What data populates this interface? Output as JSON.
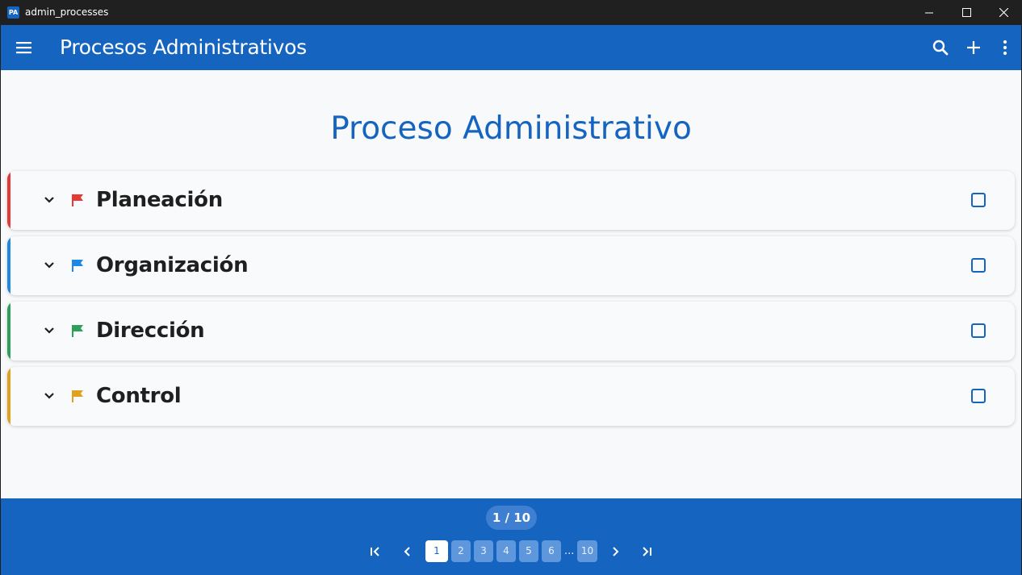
{
  "window": {
    "app_icon_text": "PA",
    "title": "admin_processes"
  },
  "appbar": {
    "title": "Procesos Administrativos",
    "icons": [
      "menu-icon",
      "search-icon",
      "add-icon",
      "more-vert-icon"
    ],
    "color": "#1565c0"
  },
  "main": {
    "heading": "Proceso Administrativo",
    "items": [
      {
        "label": "Planeación",
        "color": "#e53935",
        "checked": false
      },
      {
        "label": "Organización",
        "color": "#1e88e5",
        "checked": false
      },
      {
        "label": "Dirección",
        "color": "#2e9e5b",
        "checked": false
      },
      {
        "label": "Control",
        "color": "#e0a020",
        "checked": false
      }
    ]
  },
  "pagination": {
    "counter": "1 / 10",
    "current_page": 1,
    "pages": [
      "1",
      "2",
      "3",
      "4",
      "5",
      "6",
      "10"
    ],
    "ellipsis": "...",
    "icons": [
      "first-page-icon",
      "prev-page-icon",
      "next-page-icon",
      "last-page-icon"
    ]
  }
}
